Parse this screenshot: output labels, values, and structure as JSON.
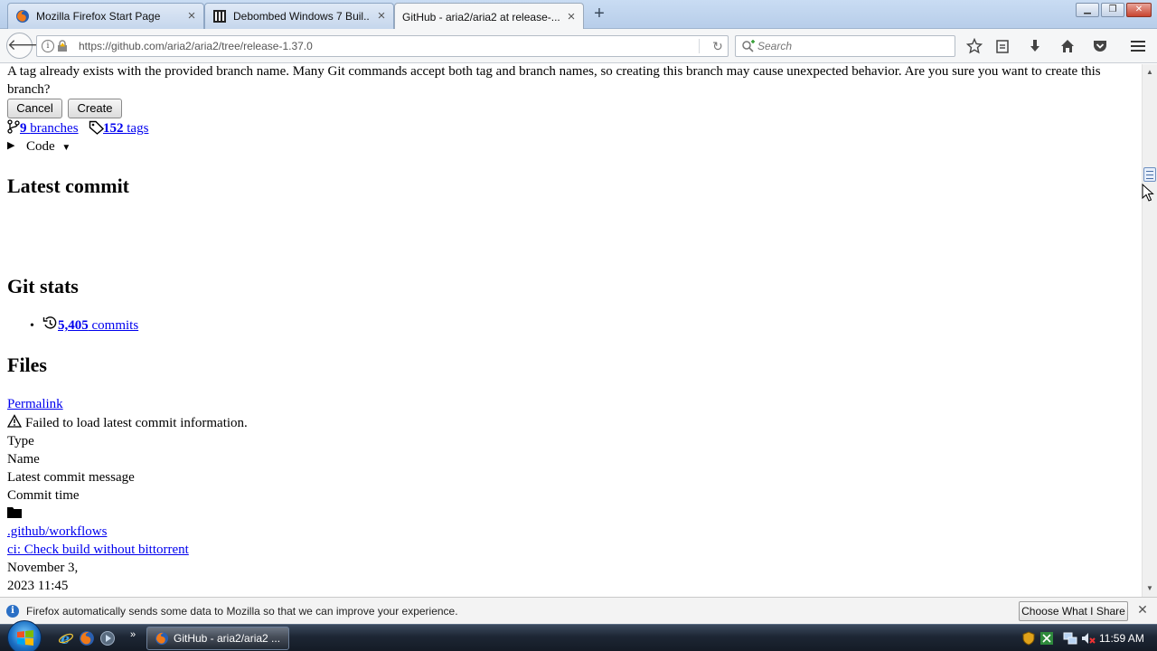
{
  "browser": {
    "tabs": [
      {
        "title": "Mozilla Firefox Start Page",
        "active": false
      },
      {
        "title": "Debombed Windows 7 Buil...",
        "active": false
      },
      {
        "title": "GitHub - aria2/aria2 at release-...",
        "active": true
      }
    ],
    "new_tab_label": "+",
    "url": "https://github.com/aria2/aria2/tree/release-1.37.0",
    "search_placeholder": "Search"
  },
  "page": {
    "warning_line1": "A tag already exists with the provided branch name. Many Git commands accept both tag and branch names, so creating this branch may cause unexpected behavior. Are you sure you want to create this",
    "warning_line2": "branch?",
    "cancel_label": "Cancel",
    "create_label": "Create",
    "branches_count": "9",
    "branches_label": "branches",
    "tags_count": "152",
    "tags_label": "tags",
    "code_label": "Code",
    "latest_commit_heading": "Latest commit",
    "git_stats_heading": "Git stats",
    "commits_count": "5,405",
    "commits_label": "commits",
    "files_heading": "Files",
    "permalink_label": "Permalink",
    "failed_message": "Failed to load latest commit information.",
    "col_type": "Type",
    "col_name": "Name",
    "col_message": "Latest commit message",
    "col_time": "Commit time",
    "file_name": ".github/workflows",
    "commit_message": "ci: Check build without bittorrent",
    "commit_date_line1": "November 3,",
    "commit_date_line2": "2023 11:45"
  },
  "notification": {
    "text": "Firefox automatically sends some data to Mozilla so that we can improve your experience.",
    "button_label": "Choose What I Share"
  },
  "taskbar": {
    "task_label": "GitHub - aria2/aria2 ...",
    "time": "11:59 AM"
  },
  "colors": {
    "link": "#0000ee",
    "taskbar_dark": "#141b26",
    "start_orb": "#1a6fc4"
  }
}
